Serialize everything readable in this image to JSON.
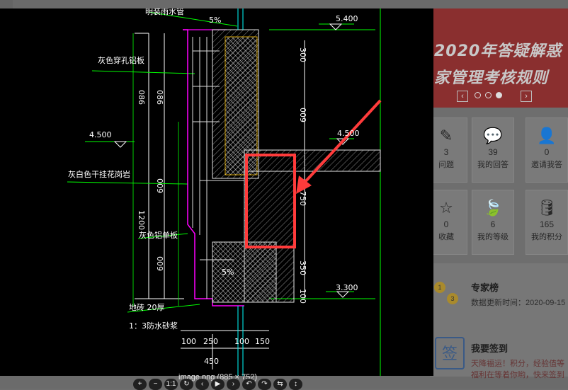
{
  "viewer": {
    "caption": "image.png (885 × 752)",
    "labels": {
      "top_note": "明装雨水管",
      "slope_top": "5%",
      "slope_low": "5%",
      "perforated_panel": "灰色穿孔铝板",
      "dry_stone": "灰白色干挂花岗岩",
      "alum_panel": "灰色铝单板",
      "floor_tile": "地砖 20厚",
      "mortar": "1：3防水砂浆"
    },
    "elevations": [
      "5.400",
      "4.500",
      "4.500",
      "3.300"
    ],
    "dims_left": [
      "086",
      "086",
      "009",
      "1200",
      "009"
    ],
    "dims_right": [
      "300",
      "009",
      "750",
      "350",
      "100"
    ],
    "dims_bottom": [
      "100",
      "250",
      "100",
      "150",
      "450"
    ]
  },
  "toolbar": {
    "buttons": [
      {
        "name": "zoom-in-button",
        "glyph": "+"
      },
      {
        "name": "zoom-out-button",
        "glyph": "−"
      },
      {
        "name": "actual-size-button",
        "glyph": "1:1"
      },
      {
        "name": "reset-button",
        "glyph": "↻"
      },
      {
        "name": "prev-button",
        "glyph": "‹"
      },
      {
        "name": "play-button",
        "glyph": "▶"
      },
      {
        "name": "next-button",
        "glyph": "›"
      },
      {
        "name": "rotate-left-button",
        "glyph": "↶"
      },
      {
        "name": "rotate-right-button",
        "glyph": "↷"
      },
      {
        "name": "flip-h-button",
        "glyph": "⇆"
      },
      {
        "name": "flip-v-button",
        "glyph": "↕"
      }
    ]
  },
  "banner": {
    "line1": "2020年答疑解惑",
    "line2": "家管理考核规则",
    "prev": "‹",
    "next": "›"
  },
  "stats": [
    {
      "icon": "✎",
      "num": "3",
      "label": "问题"
    },
    {
      "icon": "💬",
      "num": "39",
      "label": "我的回答"
    },
    {
      "icon": "👤",
      "num": "0",
      "label": "邀请我答"
    },
    {
      "icon": "☆",
      "num": "0",
      "label": "收藏"
    },
    {
      "icon": "🍃",
      "num": "6",
      "label": "我的等级"
    },
    {
      "icon": "🛢",
      "num": "165",
      "label": "我的积分"
    }
  ],
  "expert": {
    "title": "专家榜",
    "update": "数据更新时间：2020-09-15",
    "medals": [
      "1",
      "3"
    ]
  },
  "signin": {
    "icon": "签",
    "title": "我要签到",
    "line1": "天降福运！积分，经验值等",
    "line2": "福利在等着你哟，快来签到"
  },
  "colors": {
    "cad_bg": "#000000",
    "highlight": "#ff3b3b",
    "cad_green": "#00ff00",
    "cad_magenta": "#ff00ff"
  }
}
